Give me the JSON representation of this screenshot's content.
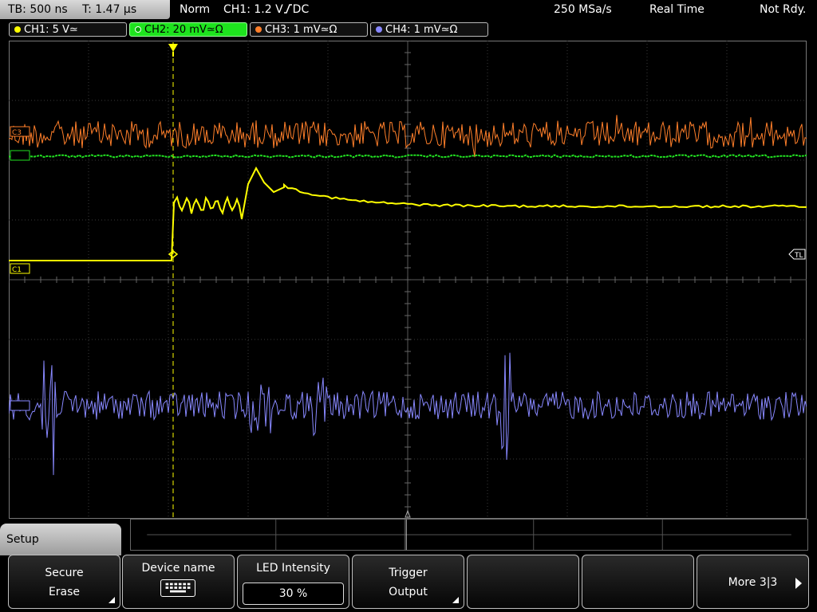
{
  "status": {
    "timebase": "TB: 500 ns",
    "trigger_time": "T: 1.47 µs",
    "mode": "Norm",
    "trigger_source": "CH1: 1.2 V",
    "trigger_edge": "rising-edge-icon",
    "trigger_coupling": "DC",
    "sample_rate": "250 MSa/s",
    "acquisition": "Real Time",
    "state": "Not Rdy."
  },
  "channels": [
    {
      "label": "CH1: 5 V≃",
      "color": "#ffff00",
      "active": false
    },
    {
      "label": "CH2: 20 mV≃Ω",
      "color": "#22e022",
      "active": true
    },
    {
      "label": "CH3: 1 mV≃Ω",
      "color": "#ff7f2a",
      "active": false
    },
    {
      "label": "CH4: 1 mV≃Ω",
      "color": "#8888ff",
      "active": false
    }
  ],
  "markers": {
    "c3": "C3",
    "c1": "C1",
    "tl": "TL"
  },
  "menu": {
    "title": "Setup",
    "softkeys": [
      {
        "line1": "Secure",
        "line2": "Erase"
      },
      {
        "line1": "Device name",
        "icon": "keyboard-icon"
      },
      {
        "line1": "LED Intensity",
        "value": "30 %"
      },
      {
        "line1": "Trigger",
        "line2": "Output"
      },
      {
        "line1": ""
      },
      {
        "line1": ""
      },
      {
        "line1": "More 3|3"
      }
    ]
  }
}
